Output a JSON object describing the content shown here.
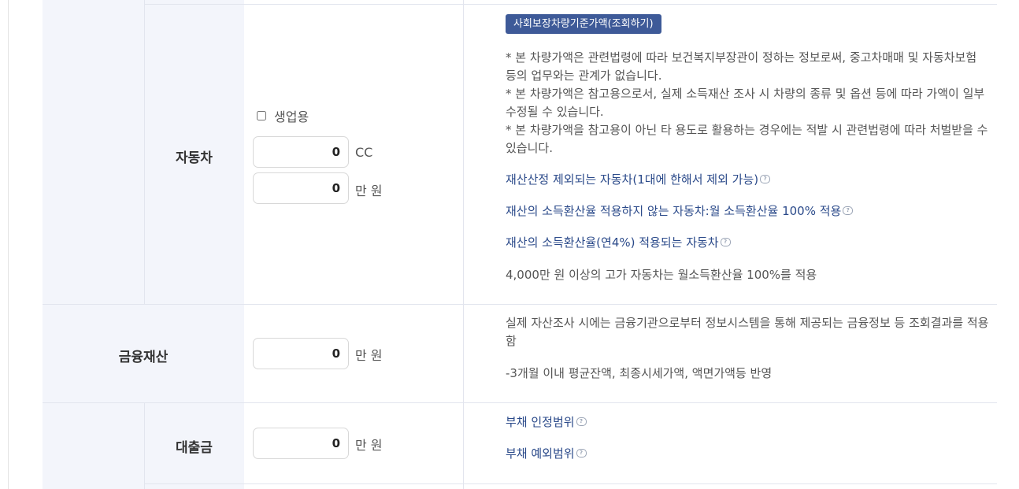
{
  "vehicle": {
    "label": "자동차",
    "business_checkbox_label": "생업용",
    "cc_value": "0",
    "cc_unit": "CC",
    "price_value": "0",
    "price_unit": "만 원",
    "lookup_button": "사회보장차량기준가액(조회하기)",
    "notes": [
      "* 본 차량가액은 관련법령에 따라 보건복지부장관이 정하는 정보로써, 중고차매매 및 자동차보험 등의 업무와는 관계가 없습니다.",
      "* 본 차량가액은 참고용으로서, 실제 소득재산 조사 시 차량의 종류 및 옵션 등에 따라 가액이 일부 수정될 수 있습니다.",
      "* 본 차량가액을 참고용이 아닌 타 용도로 활용하는 경우에는 적발 시 관련법령에 따라 처벌받을 수 있습니다."
    ],
    "links": [
      "재산산정 제외되는 자동차(1대에 한해서 제외 가능)",
      "재산의 소득환산율 적용하지 않는 자동차:월 소득환산율 100% 적용",
      "재산의 소득환산율(연4%) 적용되는 자동차"
    ],
    "footnote": "4,000만 원 이상의 고가 자동차는 월소득환산율 100%를 적용"
  },
  "financial": {
    "label": "금융재산",
    "value": "0",
    "unit": "만 원",
    "note": "실제 자산조사 시에는 금융기관으로부터 정보시스템을 통해 제공되는 금융정보 등 조회결과를 적용함",
    "note2": "-3개월 이내 평균잔액, 최종시세가액, 액면가액등 반영"
  },
  "loan": {
    "label": "대출금",
    "value": "0",
    "unit": "만 원",
    "links": [
      "부채 인정범위",
      "부채 예외범위"
    ]
  },
  "icons": {
    "info": "speech-bubble-info-icon",
    "glyph": "?"
  },
  "colors": {
    "button_bg": "#3e5a98",
    "link": "#2b4a8a",
    "label_bg": "#f3f5fb"
  }
}
